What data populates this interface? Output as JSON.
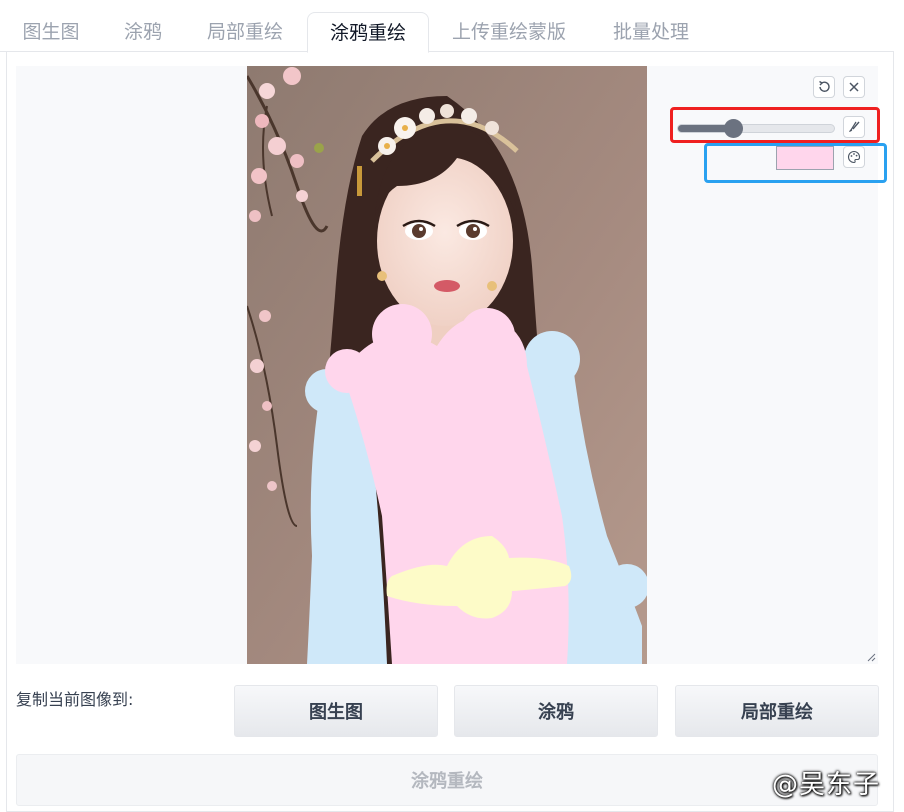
{
  "tabs": [
    {
      "label": "图生图",
      "active": false
    },
    {
      "label": "涂鸦",
      "active": false
    },
    {
      "label": "局部重绘",
      "active": false
    },
    {
      "label": "涂鸦重绘",
      "active": true
    },
    {
      "label": "上传重绘蒙版",
      "active": false
    },
    {
      "label": "批量处理",
      "active": false
    }
  ],
  "canvas": {
    "image": "portrait-photo",
    "brush_size_fraction": 0.36,
    "brush_color": "#ffd6ec",
    "sketch_colors": [
      "#ffd6ec",
      "#cfe8f9",
      "#fdfbc8"
    ],
    "icons": [
      "undo-icon",
      "close-icon",
      "brush-icon",
      "palette-icon",
      "resize-icon"
    ]
  },
  "copy_section": {
    "label": "复制当前图像到:",
    "buttons": [
      "图生图",
      "涂鸦",
      "局部重绘"
    ]
  },
  "submit_label": "涂鸦重绘",
  "watermark": "@吴东子",
  "colors": {
    "highlight_red": "#ef2020",
    "highlight_blue": "#2aa1f0",
    "canvas_bg": "#f8f9fb"
  }
}
